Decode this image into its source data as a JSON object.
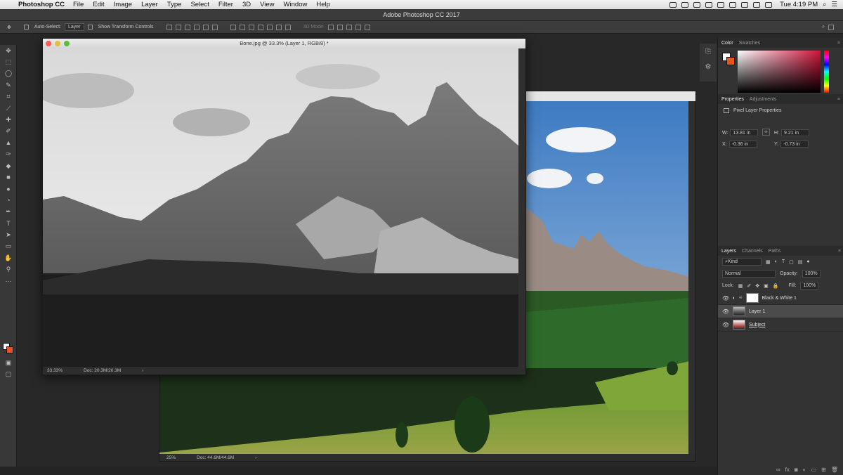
{
  "menubar": {
    "app": "Photoshop CC",
    "items": [
      "File",
      "Edit",
      "Image",
      "Layer",
      "Type",
      "Select",
      "Filter",
      "3D",
      "View",
      "Window",
      "Help"
    ],
    "clock": "Tue 4:19 PM"
  },
  "app_title": "Adobe Photoshop CC 2017",
  "options": {
    "auto_select": "Auto-Select:",
    "auto_select_value": "Layer",
    "show_transform": "Show Transform Controls",
    "mode_3d": "3D Mode:"
  },
  "doc1": {
    "title": "Bone.jpg @ 33.3% (Layer 1, RGB/8) *",
    "zoom": "33.33%",
    "doc_size": "Doc: 20.3M/20.3M"
  },
  "doc2": {
    "zoom": "25%",
    "doc_size": "Doc: 44.6M/44.6M"
  },
  "color_panel": {
    "tabs": [
      "Color",
      "Swatches"
    ],
    "fg": "#ffffff",
    "bg": "#e8541c"
  },
  "properties": {
    "tabs": [
      "Properties",
      "Adjustments"
    ],
    "header": "Pixel Layer Properties",
    "w_label": "W:",
    "w": "13.81 in",
    "h_label": "H:",
    "h": "9.21 in",
    "x_label": "X:",
    "x": "-0.36 in",
    "y_label": "Y:",
    "y": "-0.73 in"
  },
  "layers": {
    "tabs": [
      "Layers",
      "Channels",
      "Paths"
    ],
    "filter": "Kind",
    "blend": "Normal",
    "opacity_label": "Opacity:",
    "opacity": "100%",
    "lock_label": "Lock:",
    "fill_label": "Fill:",
    "fill": "100%",
    "items": [
      {
        "name": "Black & White 1"
      },
      {
        "name": "Layer 1"
      },
      {
        "name": "Subject"
      }
    ]
  }
}
